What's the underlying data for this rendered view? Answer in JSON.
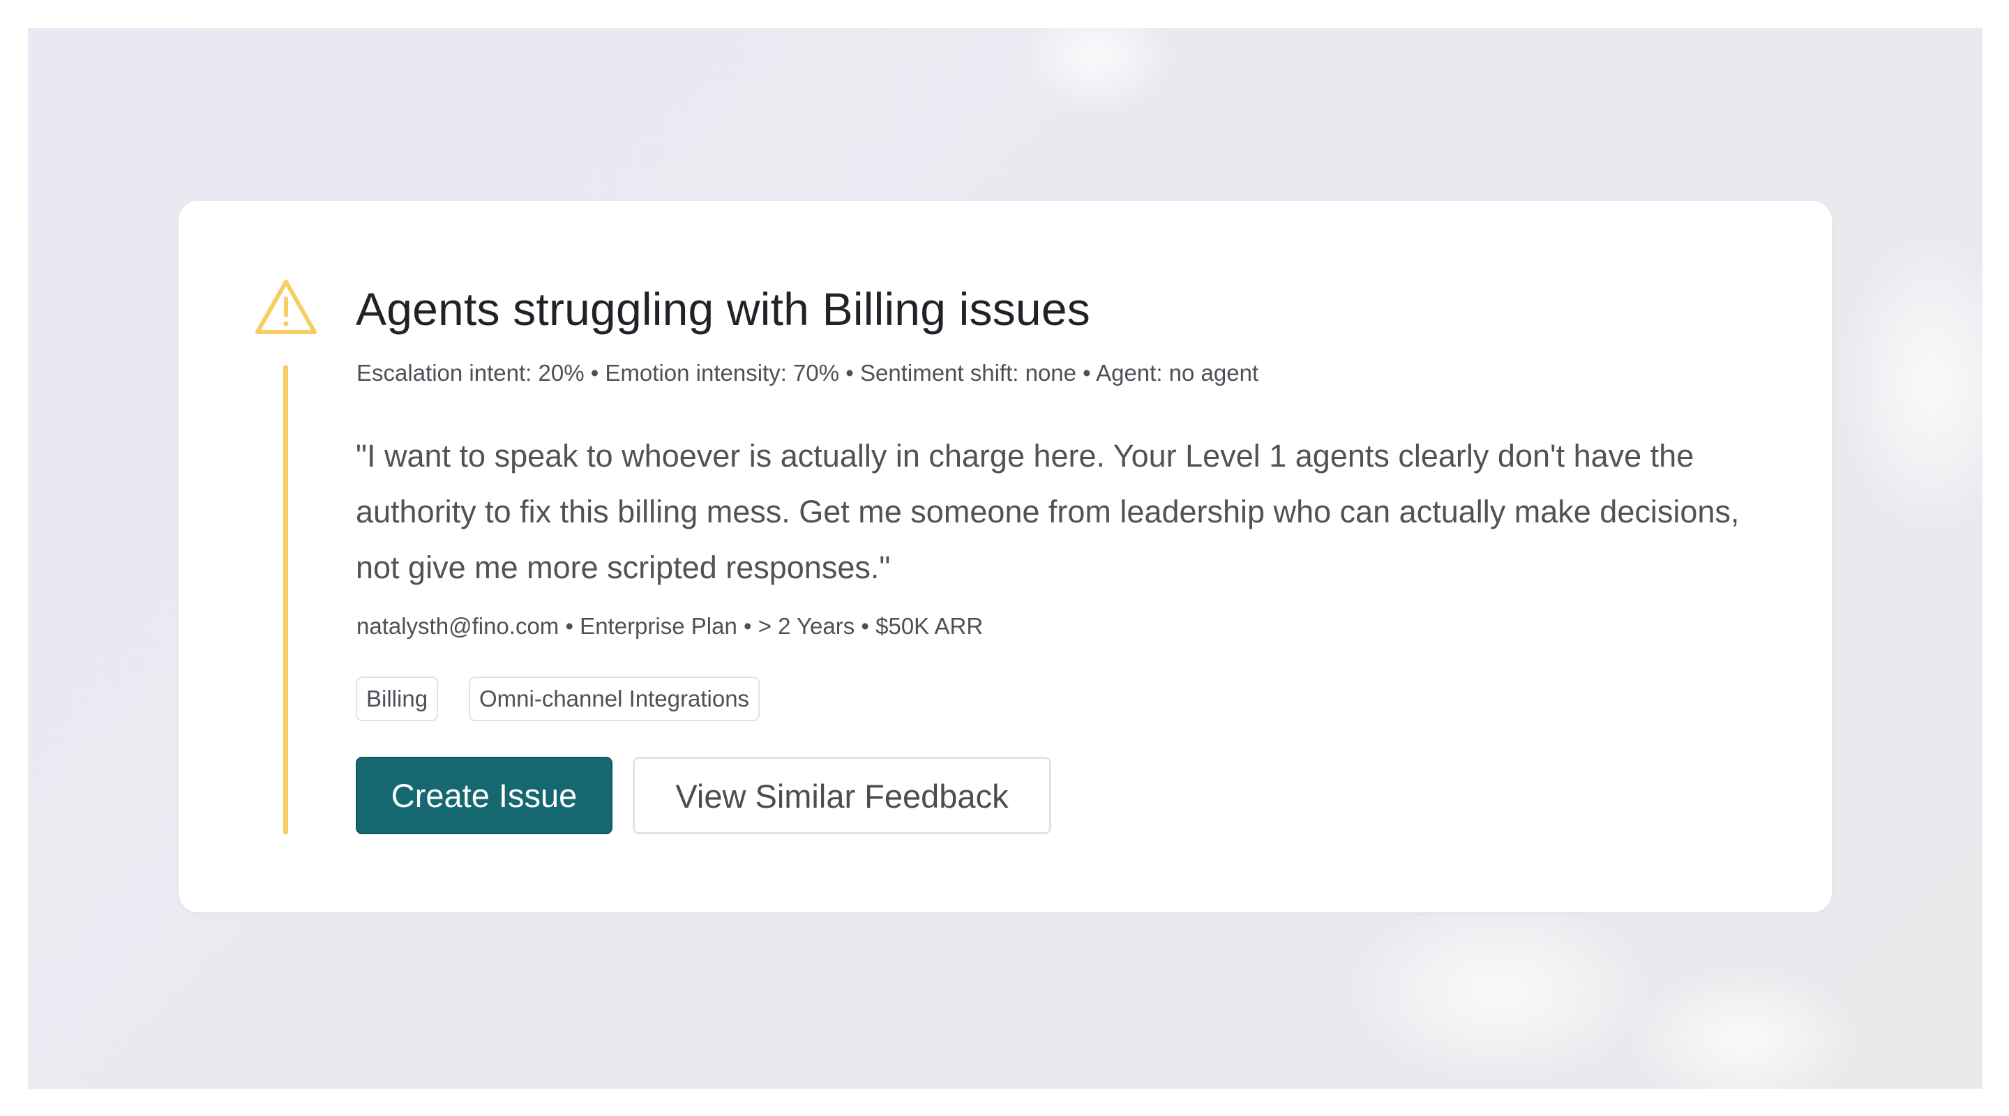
{
  "card": {
    "title": "Agents struggling with Billing issues",
    "metrics": "Escalation intent: 20% • Emotion intensity: 70% • Sentiment shift: none • Agent: no agent",
    "quote": "\"I want to speak to whoever is actually in charge here. Your Level 1 agents clearly don't have the authority to fix this billing mess. Get me someone from leadership who can actually make decisions, not give me more scripted responses.\"",
    "customer": "natalysth@fino.com • Enterprise Plan • > 2 Years • $50K ARR",
    "tags": [
      "Billing",
      "Omni-channel Integrations"
    ],
    "actions": {
      "primary_label": "Create Issue",
      "secondary_label": "View Similar Feedback"
    }
  },
  "icons": {
    "alert": "warning-triangle-icon"
  },
  "colors": {
    "accent_warning": "#f5cd63",
    "primary_button": "#166870",
    "title_text": "#1f2328",
    "body_text": "#4f5358",
    "backdrop": "#ebe9f0"
  }
}
